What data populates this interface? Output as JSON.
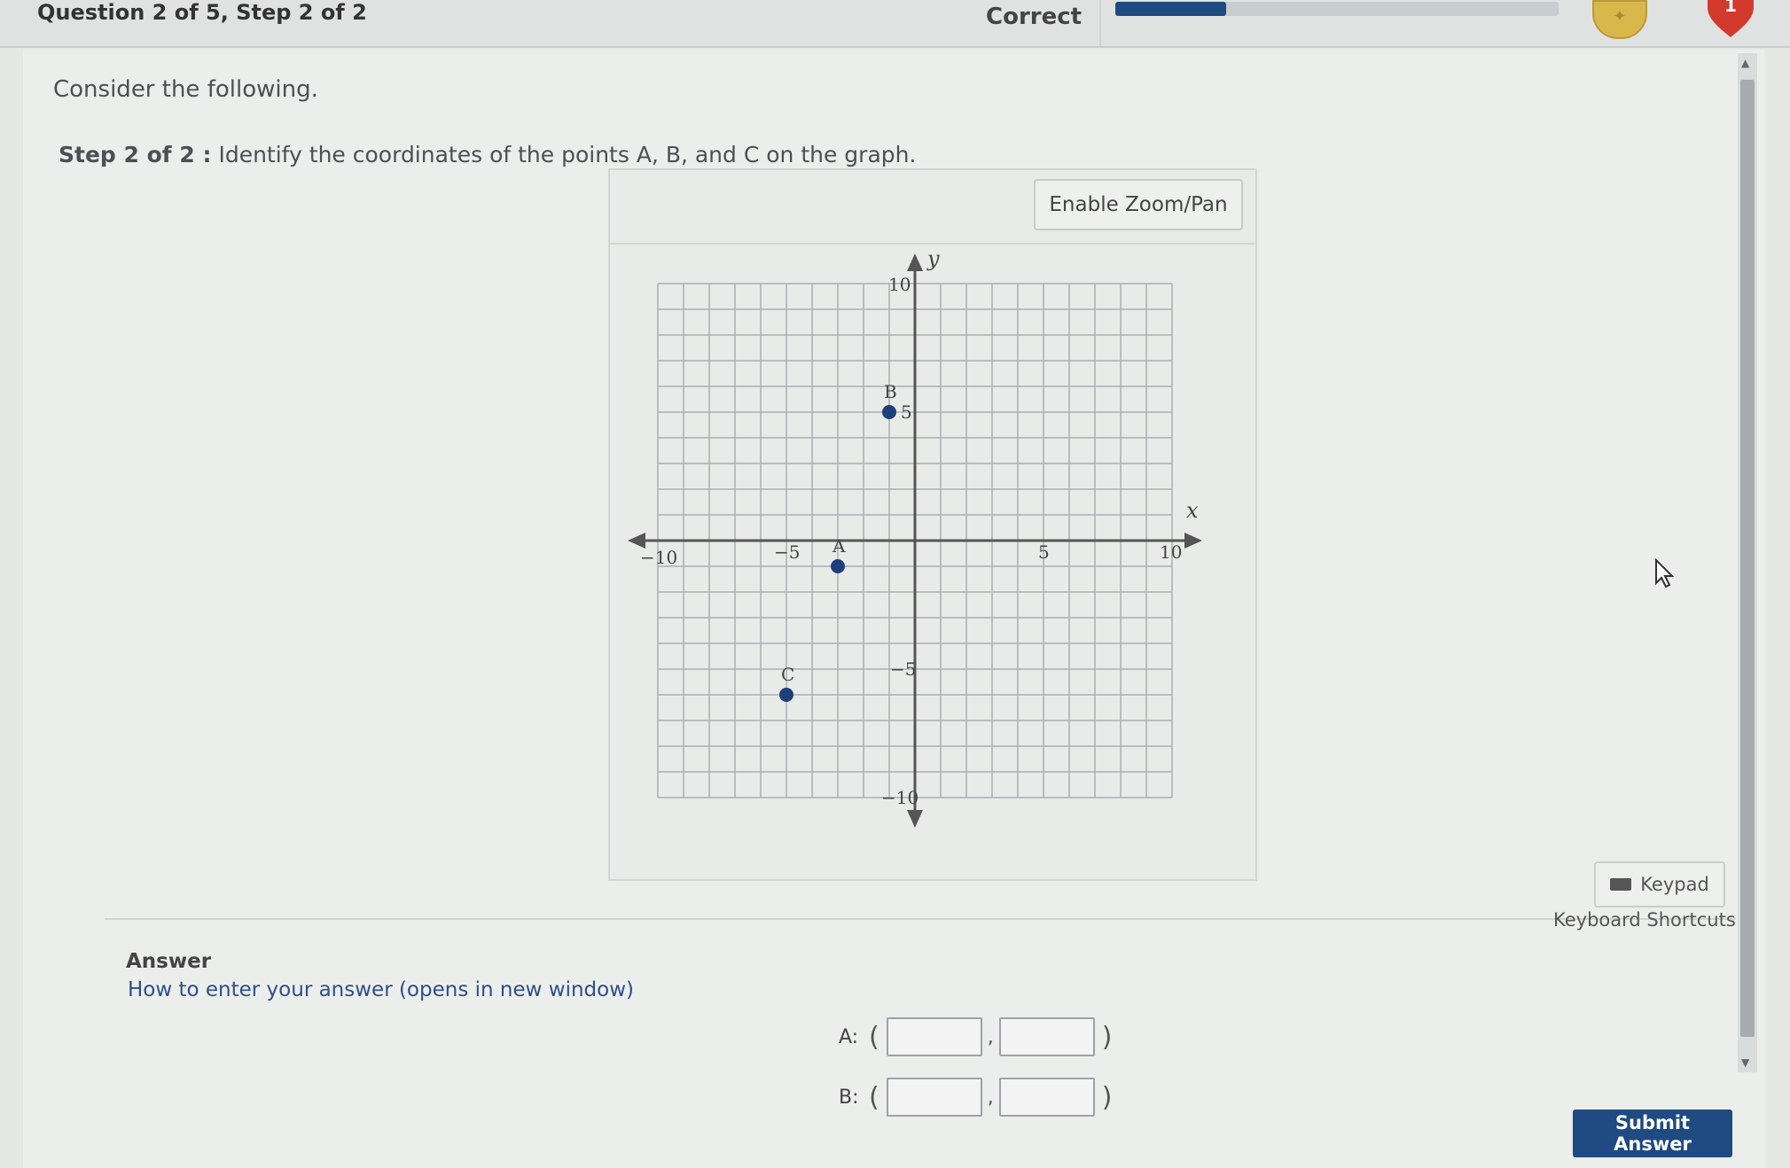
{
  "header": {
    "question_info": "Question 2 of 5, Step 2 of 2",
    "status": "Correct",
    "progress": 0.25,
    "hearts": "1",
    "coin_icon": "coin-icon",
    "heart_icon": "heart-icon"
  },
  "content": {
    "intro": "Consider the following.",
    "step_label": "Step 2 of 2 :",
    "step_text": "Identify the coordinates of the points A, B, and C on the graph."
  },
  "graph": {
    "zoom_button": "Enable Zoom/Pan",
    "x_axis_label": "x",
    "y_axis_label": "y",
    "tick_labels": {
      "x_neg10": "−10",
      "x_neg5": "−5",
      "x_5": "5",
      "x_10": "10",
      "y_10": "10",
      "y_5": "5",
      "y_neg5": "−5",
      "y_neg10": "−10"
    },
    "points": [
      {
        "label": "A",
        "x": -3,
        "y": -1
      },
      {
        "label": "B",
        "x": -1,
        "y": 5
      },
      {
        "label": "C",
        "x": -5,
        "y": -6
      }
    ],
    "x_range": [
      -10,
      10
    ],
    "y_range": [
      -10,
      10
    ],
    "grid": true,
    "point_color": "#1f3f7a"
  },
  "answer": {
    "heading": "Answer",
    "help_link": "How to enter your answer (opens in new window)",
    "keypad_label": "Keypad",
    "shortcuts_label": "Keyboard Shortcuts",
    "rows": [
      {
        "label": "A:",
        "x_value": "",
        "y_value": ""
      },
      {
        "label": "B:",
        "x_value": "",
        "y_value": ""
      }
    ],
    "open_paren": "(",
    "close_paren": ")",
    "comma": ",",
    "submit_label": "Submit Answer"
  },
  "colors": {
    "accent": "#1f4a82",
    "link": "#2d4f8a",
    "heart": "#d23a2e",
    "coin": "#d8b84a"
  }
}
